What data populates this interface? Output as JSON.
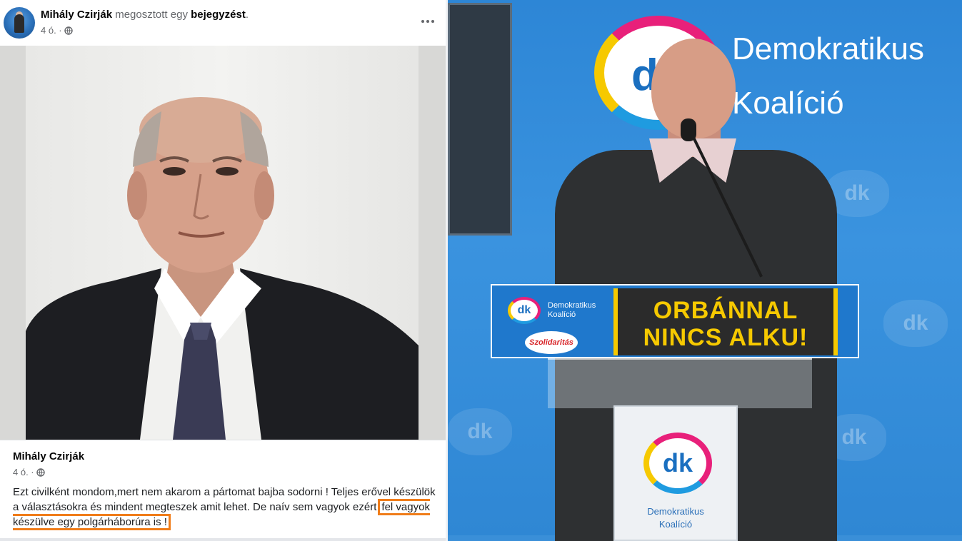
{
  "post": {
    "author": "Mihály Czirják",
    "shared_text": "megosztott egy",
    "post_word": "bejegyzést",
    "trailing": ".",
    "time": "4 ó. ·",
    "shared": {
      "author": "Mihály Czirják",
      "time": "4 ó. ·",
      "body_start": "Ezt civilként mondom,mert nem akarom a pártomat bajba sodorni ! Teljes erővel készülök a választásokra és mindent megteszek amit lehet. De naív sem vagyok ezért",
      "body_highlight": "fel vagyok készülve egy polgárháborúra is !"
    }
  },
  "press": {
    "banner_line1": "Demokratikus",
    "banner_line2": "Koalíció",
    "logo_text": "dk",
    "watermark_text": "dk",
    "podium_party_line1": "Demokratikus",
    "podium_party_line2": "Koalíció",
    "solidarity_text": "Szolidaritás",
    "slogan_line1": "ORBÁNNAL",
    "slogan_line2": "NINCS ALKU!",
    "column_name_line1": "Demokratikus",
    "column_name_line2": "Koalíció"
  },
  "colors": {
    "highlight": "#f07d1a",
    "dk_blue": "#1f78cc",
    "slogan_yellow": "#f6c900"
  }
}
